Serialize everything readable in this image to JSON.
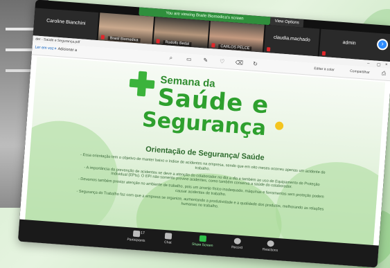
{
  "zoom": {
    "share_banner": "You are viewing Braile Biomedica's screen",
    "view_options": "View Options",
    "participants_tiles": [
      {
        "name": "Caroline Bianchini",
        "video": false
      },
      {
        "name": "Brasil Biomedica",
        "video": true
      },
      {
        "name": "Rodolfo Bedal",
        "video": true
      },
      {
        "name": "CARLOS PELCE",
        "video": true
      },
      {
        "name": "claudia.machado",
        "video": false
      },
      {
        "name": "admin",
        "video": false
      }
    ],
    "next_label": "›",
    "controls": {
      "participants": "Participants",
      "participants_count": "17",
      "chat": "Chat",
      "share_screen": "Share Screen",
      "record": "Record",
      "reactions": "Reactions"
    }
  },
  "window": {
    "title": "der - Saúde e Segurança.pdf",
    "toolbar": {
      "read_aloud": "Ler em voz",
      "add": "Adicionar a",
      "draw_label": "Editar a colar",
      "share": "Compartilhar"
    }
  },
  "slide": {
    "logo_semana": "Semana da",
    "logo_saude": "Saúde e",
    "logo_seguranca": "Segurança",
    "heading": "Orientação de Segurança/ Saúde",
    "bullets": [
      "- Essa orientação tem o objetivo de manter baixo o índice de acidentes na empresa, sendo que em oito meses ocorreu apenas um acidente de trabalho.",
      "- A importância da prevenção de acidentes se deve a atenção do colaborador no dia a dia e também ao uso de Equipamento de Proteção Individual (EPIs). O EPI não somente previne acidentes, como também conserva a saúde do colaborador.",
      "- Devemos também prestar atenção no ambiente de trabalho, pois um arranjo físico inadequado, máquinas e ferramentas sem proteção podem causar acidentes de trabalho.",
      "- Segurança do Trabalho faz com que a empresa se organize, aumentando a produtividade e a qualidade dos produtos, melhorando as relações humanas no trabalho."
    ]
  },
  "colors": {
    "accent_green": "#2ea02e",
    "zoom_blue": "#2d8cff",
    "mute_red": "#e0272b"
  }
}
